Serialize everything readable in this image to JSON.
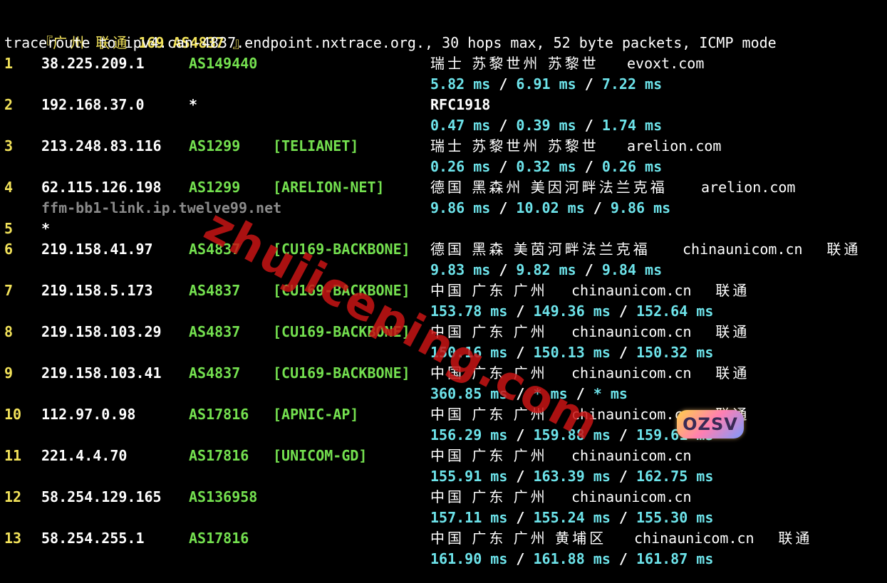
{
  "header": {
    "bracket_open": "『",
    "city": "广州",
    "isp": "联通",
    "net": "169 AS4837",
    "bracket_close": "』",
    "command_line": "traceroute to ipv4.can-4837.endpoint.nxtrace.org., 30 hops max, 52 byte packets, ICMP mode"
  },
  "hops": [
    {
      "hop": "1",
      "ip": "38.225.209.1",
      "asn": "AS149440",
      "tag": "",
      "geo": "瑞士 苏黎世州 苏黎世",
      "domain": "evoxt.com",
      "carrier": "",
      "rdns": "",
      "rtt": [
        "5.82 ms",
        "6.91 ms",
        "7.22 ms"
      ]
    },
    {
      "hop": "2",
      "ip": "192.168.37.0",
      "asn": "*",
      "tag": "",
      "geo": "RFC1918",
      "domain": "",
      "carrier": "",
      "rdns": "",
      "rtt": [
        "0.47 ms",
        "0.39 ms",
        "1.74 ms"
      ]
    },
    {
      "hop": "3",
      "ip": "213.248.83.116",
      "asn": "AS1299",
      "tag": "[TELIANET]",
      "geo": "瑞士 苏黎世州 苏黎世",
      "domain": "arelion.com",
      "carrier": "",
      "rdns": "",
      "rtt": [
        "0.26 ms",
        "0.32 ms",
        "0.26 ms"
      ]
    },
    {
      "hop": "4",
      "ip": "62.115.126.198",
      "asn": "AS1299",
      "tag": "[ARELION-NET]",
      "geo": "德国 黑森州 美因河畔法兰克福",
      "domain": "arelion.com",
      "carrier": "",
      "rdns": "ffm-bb1-link.ip.twelve99.net",
      "rtt": [
        "9.86 ms",
        "10.02 ms",
        "9.86 ms"
      ]
    },
    {
      "hop": "5",
      "ip": "*",
      "asn": "",
      "tag": "",
      "geo": "",
      "domain": "",
      "carrier": "",
      "rdns": "",
      "rtt": []
    },
    {
      "hop": "6",
      "ip": "219.158.41.97",
      "asn": "AS4837",
      "tag": "[CU169-BACKBONE]",
      "geo": "德国 黑森 美茵河畔法兰克福",
      "domain": "chinaunicom.cn",
      "carrier": "联通",
      "rdns": "",
      "rtt": [
        "9.83 ms",
        "9.82 ms",
        "9.84 ms"
      ]
    },
    {
      "hop": "7",
      "ip": "219.158.5.173",
      "asn": "AS4837",
      "tag": "[CU169-BACKBONE]",
      "geo": "中国 广东 广州",
      "domain": "chinaunicom.cn",
      "carrier": "联通",
      "rdns": "",
      "rtt": [
        "153.78 ms",
        "149.36 ms",
        "152.64 ms"
      ]
    },
    {
      "hop": "8",
      "ip": "219.158.103.29",
      "asn": "AS4837",
      "tag": "[CU169-BACKBONE]",
      "geo": "中国 广东 广州",
      "domain": "chinaunicom.cn",
      "carrier": "联通",
      "rdns": "",
      "rtt": [
        "150.16 ms",
        "150.13 ms",
        "150.32 ms"
      ]
    },
    {
      "hop": "9",
      "ip": "219.158.103.41",
      "asn": "AS4837",
      "tag": "[CU169-BACKBONE]",
      "geo": "中国 广东 广州",
      "domain": "chinaunicom.cn",
      "carrier": "联通",
      "rdns": "",
      "rtt": [
        "360.85 ms",
        "* ms",
        "* ms"
      ]
    },
    {
      "hop": "10",
      "ip": "112.97.0.98",
      "asn": "AS17816",
      "tag": "[APNIC-AP]",
      "geo": "中国 广东 广州",
      "domain": "chinaunicom.cn",
      "carrier": "联通",
      "rdns": "",
      "rtt": [
        "156.29 ms",
        "159.88 ms",
        "159.61 ms"
      ]
    },
    {
      "hop": "11",
      "ip": "221.4.4.70",
      "asn": "AS17816",
      "tag": "[UNICOM-GD]",
      "geo": "中国 广东 广州",
      "domain": "chinaunicom.cn",
      "carrier": "",
      "rdns": "",
      "rtt": [
        "155.91 ms",
        "163.39 ms",
        "162.75 ms"
      ]
    },
    {
      "hop": "12",
      "ip": "58.254.129.165",
      "asn": "AS136958",
      "tag": "",
      "geo": "中国 广东 广州",
      "domain": "chinaunicom.cn",
      "carrier": "",
      "rdns": "",
      "rtt": [
        "157.11 ms",
        "155.24 ms",
        "155.30 ms"
      ]
    },
    {
      "hop": "13",
      "ip": "58.254.255.1",
      "asn": "AS17816",
      "tag": "",
      "geo": "中国 广东 广州 黄埔区",
      "domain": "chinaunicom.cn",
      "carrier": "联通",
      "rdns": "",
      "rtt": [
        "161.90 ms",
        "161.88 ms",
        "161.87 ms"
      ]
    }
  ],
  "rtt_separator": " / ",
  "watermark": "zhujiceping.com",
  "logo_text": "OZSV",
  "colors": {
    "background": "#000000",
    "hop_number": "#f2e25a",
    "ip": "#ffffff",
    "asn": "#74e04f",
    "rtt": "#6de3ea",
    "rdns": "#8a8a8a",
    "watermark": "#c81414"
  }
}
